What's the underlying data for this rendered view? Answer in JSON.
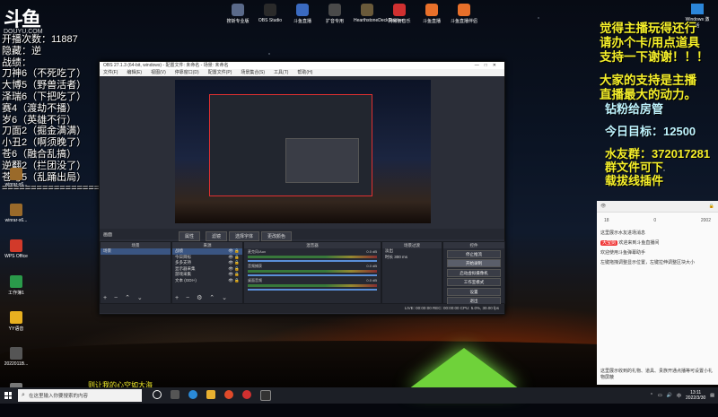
{
  "logo": {
    "mark": "斗鱼",
    "sub": "DOUYU.COM"
  },
  "left_info": "开播次数：11887\n隐藏：逆\n战绩：\n刀神6（不死吃了）\n大博5（野兽活者）\n泽瑞6（下把吃了）\n赛4（渡劫不播）\n岁6（英雄不行）\n刀面2（掘金满满）\n小丑2（啊须晚了）\n苍6（融合乱搞）\n逆翻2（拦团没了）\n苍穹5（乱踊出局）\n=================",
  "desktop_icons": [
    {
      "label": "winrar-x6...",
      "color": "#9a6a2a"
    },
    {
      "label": "winrar-x6...",
      "color": "#9a6a2a"
    },
    {
      "label": "WPS Office",
      "color": "#d23a2a"
    },
    {
      "label": "工作簿1",
      "color": "#2a9a4a"
    },
    {
      "label": "YY语音",
      "color": "#e8b020"
    },
    {
      "label": "2022011B...",
      "color": "#555"
    },
    {
      "label": "20年春节回顾",
      "color": "#777"
    }
  ],
  "top_icons": [
    {
      "label": "搜斩专业版",
      "color": "#5a6a8a"
    },
    {
      "label": "OBS Studio",
      "color": "#2a2a2a"
    },
    {
      "label": "斗鱼直播",
      "color": "#3a6ac0"
    },
    {
      "label": "扩音专用",
      "color": "#4a4a4a"
    },
    {
      "label": "HearthstoneDeckTracker",
      "color": "#6a5a3a"
    },
    {
      "label": "网易云音乐",
      "color": "#d03030"
    },
    {
      "label": "斗鱼直播",
      "color": "#e8702a"
    },
    {
      "label": "斗鱼直播伴侣",
      "color": "#e8702a"
    }
  ],
  "windows_icon": {
    "label": "Windows 激活"
  },
  "right_text": {
    "promo": [
      "觉得主播玩得还行",
      "请办个卡/用点道具",
      "支持一下谢谢！！！"
    ],
    "support": [
      "大家的支持是主播",
      "直播最大的动力。"
    ],
    "gift": "钻粉给房管",
    "goal": "今日目标：12500",
    "qq": "水友群：372017281",
    "file": "群文件可下",
    "plugin": "载拔线插件"
  },
  "chat": {
    "stat_left": "18",
    "stat_mid": "0",
    "stat_right": "2002",
    "msgs": [
      "这里展示水友进场消息",
      "欢迎来到斗鱼直播间",
      "欢迎使用斗鱼弹幕助手",
      "左键拖拽调整显示位置，左键拉伸调整区块大小"
    ],
    "tag": "大宝剑",
    "hint": "这里展示收到的礼物、道具、贵族开通点播等可设置小礼物屏蔽"
  },
  "obs": {
    "title": "OBS 27.1.3 (64-bit, windows) - 配置文件: 未命名 - 场景: 未命名",
    "menu": [
      "文件(F)",
      "编辑(E)",
      "视图(V)",
      "停靠窗口(D)",
      "配置文件(P)",
      "场景集合(S)",
      "工具(T)",
      "帮助(H)"
    ],
    "scene_bar": [
      "画面",
      "属性",
      "滤镜",
      "选择字体",
      "更改颜色"
    ],
    "panels": {
      "scenes": {
        "title": "场景",
        "items": [
          "场景"
        ]
      },
      "sources": {
        "title": "来源",
        "items": [
          "战绩",
          "今日目标",
          "多多支持",
          "显示器采集",
          "游戏采集",
          "文本 (GDI+)"
        ]
      },
      "mixer": {
        "title": "混音器",
        "rows": [
          {
            "name": "麦克风/Aux",
            "db": "0.0 dB"
          },
          {
            "name": "音频捕获",
            "db": "0.0 dB"
          },
          {
            "name": "桌面音频",
            "db": "0.0 dB"
          }
        ]
      },
      "transitions": {
        "title": "场景过渡",
        "type": "淡出",
        "duration_label": "时长",
        "duration": "300 ms"
      },
      "controls": {
        "title": "控件",
        "buttons": [
          "停止推流",
          "开始录制",
          "启动虚拟摄像机",
          "工作室模式",
          "设置",
          "退出"
        ]
      }
    },
    "status": "LIVE: 00:00:00   REC: 00:00:00   CPU: 5.0%, 30.00 fps"
  },
  "overlay_text": "则让我的心空如大海",
  "taskbar": {
    "search_placeholder": "在这里输入你要搜索的内容",
    "tray_time": "13:11",
    "tray_date": "2022/3/30",
    "tray_lang": "中"
  }
}
